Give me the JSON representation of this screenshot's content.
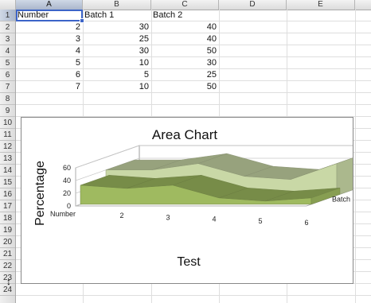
{
  "columns": [
    "A",
    "B",
    "C",
    "D",
    "E"
  ],
  "rows": [
    "1",
    "2",
    "3",
    "4",
    "5",
    "6",
    "7",
    "8",
    "9",
    "10",
    "11",
    "12",
    "13",
    "14",
    "15",
    "16",
    "17",
    "18",
    "19",
    "20",
    "21",
    "22",
    "23",
    "24"
  ],
  "table": {
    "headers": [
      "Number",
      "Batch 1",
      "Batch 2"
    ],
    "rows": [
      [
        "2",
        "30",
        "40"
      ],
      [
        "3",
        "25",
        "40"
      ],
      [
        "4",
        "30",
        "50"
      ],
      [
        "5",
        "10",
        "30"
      ],
      [
        "6",
        "5",
        "25"
      ],
      [
        "7",
        "10",
        "50"
      ]
    ]
  },
  "chart_data": {
    "type": "area",
    "title": "Area Chart",
    "xlabel": "Test",
    "ylabel": "Percentage",
    "categories": [
      "Number",
      "2",
      "3",
      "4",
      "5",
      "6"
    ],
    "yticks": [
      "0",
      "20",
      "40",
      "60"
    ],
    "ylim": [
      0,
      60
    ],
    "series": [
      {
        "name": "Batch 1",
        "values": [
          30,
          25,
          30,
          10,
          5,
          10
        ],
        "color": "#9fba60"
      },
      {
        "name": "Batch 2",
        "values": [
          40,
          40,
          50,
          30,
          25,
          50
        ],
        "color": "#c9d8a6"
      }
    ]
  },
  "colors": {
    "grid": "#dedede",
    "header_bg": "#e4e4e4",
    "selection": "#3c64c8"
  }
}
